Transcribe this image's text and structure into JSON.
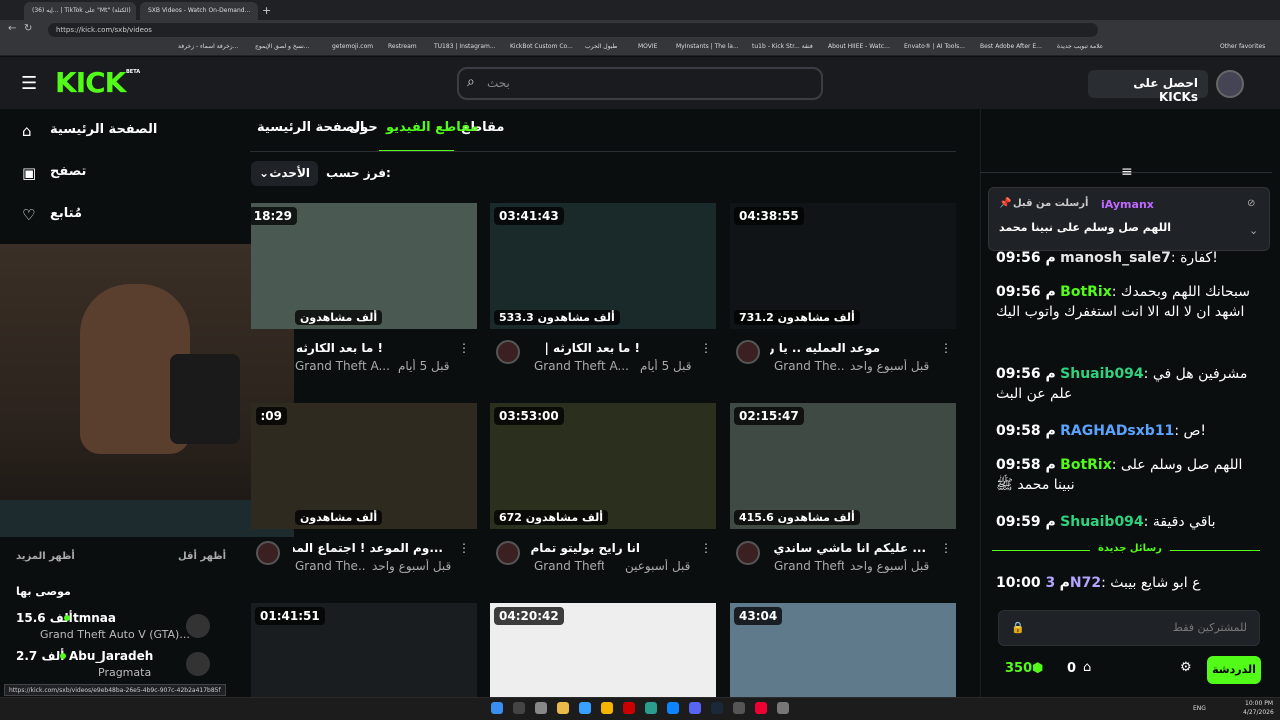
{
  "browser": {
    "tabs": [
      "(36) إيه... | TikTok على \"Mt\" (الكتلة)",
      "SXB Videos - Watch On-Demand..."
    ],
    "url": "https://kick.com/sxb/videos",
    "bookmarks": [
      "زخرفة اسماء - زخرفة...",
      "نسخ و لصق الإيموج...",
      "getemoji.com",
      "Restream",
      "TU183 | Instagram...",
      "KickBot Custom Co...",
      "طبول الحرب",
      "MOVIE",
      "MyInstants | The la...",
      "tu1b - Kick Str... فنقة",
      "About HIIEE - Watc...",
      "Envato® | AI Tools...",
      "Best Adobe After E...",
      "علامة تبويب جديدة",
      "Other favorites"
    ]
  },
  "header": {
    "logo": "KICK",
    "logo_badge": "BETA",
    "search_placeholder": "بحث",
    "kicks_button": "احصل على KICKs"
  },
  "sidebar": {
    "items": [
      "الصفحة الرئيسية",
      "تصفح",
      "مُتابع"
    ],
    "show_more": "أظهر المزيد",
    "show_less": "أظهر أقل",
    "recommended_title": "موصى بها",
    "recommended": [
      {
        "name": "tmnaa",
        "game": "Grand Theft Auto V (GTA)...",
        "viewers": "15.6 ألف"
      },
      {
        "name": "Abu_Jaradeh",
        "game": "Pragmata",
        "viewers": "2.7 ألف"
      }
    ]
  },
  "channel_tabs": [
    "مقاطع",
    "مقاطع الفيديو",
    "حول",
    "الصفحة الرئيسية"
  ],
  "sort": {
    "label": "فرز حسب:",
    "value": "الأحدث"
  },
  "videos": [
    {
      "duration": "04:38:55",
      "views": "731.2 ألف مشاهدون",
      "title": "موعد العمليه .. يا رب",
      "game": "Grand The...",
      "ago": "قبل أسبوع واحد"
    },
    {
      "duration": "03:41:43",
      "views": "533.3 ألف مشاهدون",
      "title": "! ما بعد الكارثه |",
      "game": "Grand Theft A...",
      "ago": "قبل 5 أيام"
    },
    {
      "duration": "18:29",
      "views": "ألف مشاهدون",
      "title": "! ما بعد الكارثه |",
      "game": "Grand Theft A...",
      "ago": "قبل 5 أيام"
    },
    {
      "duration": "02:15:47",
      "views": "415.6 ألف مشاهدون",
      "title": "... عليكم انا ماشي ساندي الاالان",
      "game": "Grand Theft ...",
      "ago": "قبل أسبوع واحد"
    },
    {
      "duration": "03:53:00",
      "views": "672 ألف مشاهدون",
      "title": "انا رايح بوليتو تمام ؟",
      "game": "Grand Theft ...",
      "ago": "قبل أسبوعين"
    },
    {
      "duration": ":09",
      "views": "ألف مشاهدون",
      "title": "...وم الموعد ! اجتماع المدينه",
      "game": "Grand The...",
      "ago": "قبل أسبوع واحد"
    },
    {
      "duration": "43:04",
      "views": "",
      "title": "",
      "game": "",
      "ago": ""
    },
    {
      "duration": "04:20:42",
      "views": "",
      "title": "",
      "game": "",
      "ago": ""
    },
    {
      "duration": "01:41:51",
      "views": "",
      "title": "",
      "game": "",
      "ago": ""
    }
  ],
  "chat": {
    "pinned_user": "iAymanx",
    "pinned_by": "أرسلت من قبل",
    "pinned_message": "اللهم صل وسلم على نبينا محمد",
    "messages": [
      {
        "time": "09:56 م",
        "user": "manosh_sale7",
        "color": "#e6e6e6",
        "text": "كفارة!"
      },
      {
        "time": "09:56 م",
        "user": "BotRix",
        "color": "#53fc18",
        "text": "سبحانك اللهم وبحمدك اشهد ان لا اله الا انت استغفرك واتوب اليك"
      },
      {
        "time": "09:56 م",
        "user": "Shuaib094",
        "color": "#2fd37f",
        "text": "مشرفين هل في علم عن البث"
      },
      {
        "time": "09:58 م",
        "user": "RAGHADsxb11",
        "color": "#5aa4ff",
        "text": "ص!"
      },
      {
        "time": "09:58 م",
        "user": "BotRix",
        "color": "#53fc18",
        "text": "اللهم صل وسلم على نبينا محمد ﷺ"
      },
      {
        "time": "09:59 م",
        "user": "Shuaib094",
        "color": "#2fd37f",
        "text": "باقي دقيقة"
      },
      {
        "time": "10:00 م",
        "user": "3N72",
        "color": "#b5a4ff",
        "text": "ع ابو شايع بيبث"
      }
    ],
    "sub_divider": "رسائل جديدة",
    "input_placeholder": "للمشتركين فقط",
    "points": "350",
    "kicks": "0",
    "send_button": "الدردشة"
  },
  "statusbar_url": "https://kick.com/sxb/videos/e9eb48ba-26e5-4b9c-907c-42b2a417b85f",
  "taskbar": {
    "lang": "ENG",
    "time": "10:00 PM",
    "date": "4/27/2026"
  },
  "colors": {
    "accent": "#53fc18",
    "bg": "#0b0e0f",
    "panel": "#191b1f"
  }
}
